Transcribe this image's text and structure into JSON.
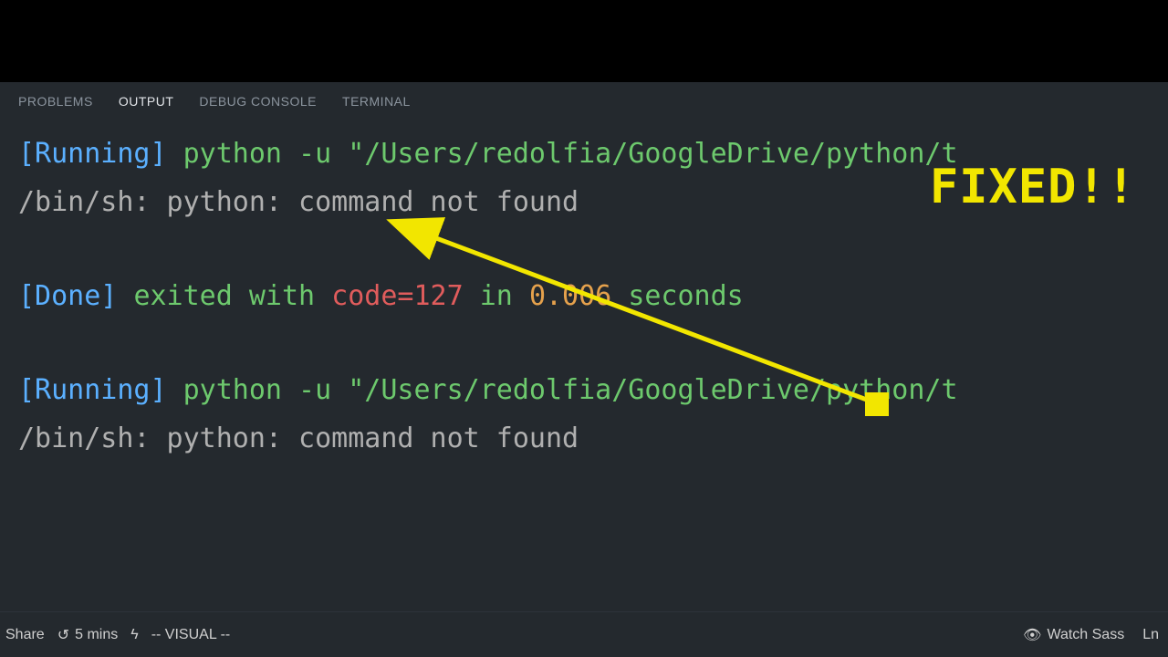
{
  "tabs": {
    "problems": "PROBLEMS",
    "output": "OUTPUT",
    "debug": "DEBUG CONSOLE",
    "terminal": "TERMINAL"
  },
  "output": {
    "run1": {
      "tag": "[Running]",
      "cmd": "python -u \"/Users/redolfia/GoogleDrive/python/t"
    },
    "err1": "/bin/sh: python: command not found",
    "done": {
      "tag": "[Done]",
      "pre": "exited with",
      "code": "code=127",
      "in": "in",
      "time": "0.006",
      "post": "seconds"
    },
    "run2": {
      "tag": "[Running]",
      "cmd": "python -u \"/Users/redolfia/GoogleDrive/python/t"
    },
    "err2": "/bin/sh: python: command not found"
  },
  "annotation": {
    "fixed": "FIXED!!"
  },
  "status": {
    "share": "Share",
    "time": "5 mins",
    "mode": "-- VISUAL --",
    "watch": "Watch Sass",
    "ln": "Ln"
  },
  "colors": {
    "bg": "#24292e",
    "blue": "#5bb0ff",
    "green": "#6dc96d",
    "red": "#e05c5c",
    "orange": "#e5a14c",
    "annotation": "#f2e600"
  }
}
